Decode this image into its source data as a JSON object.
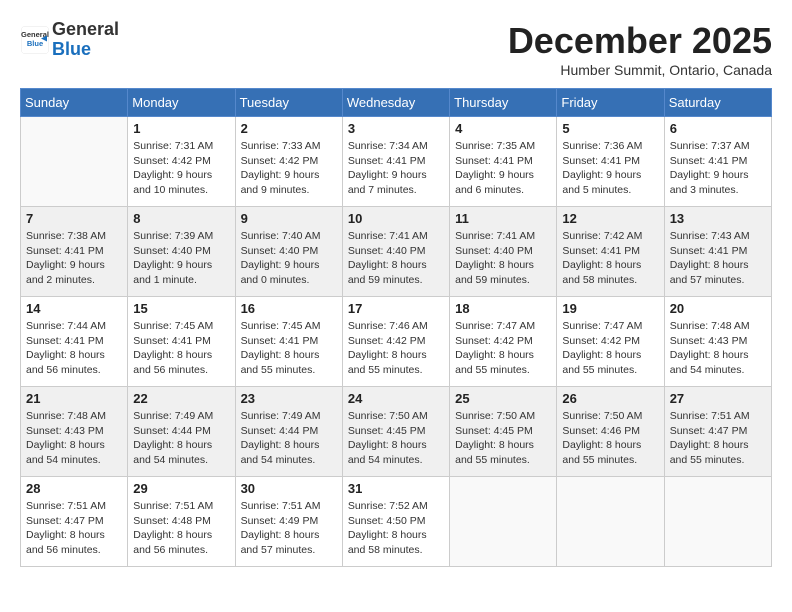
{
  "logo": {
    "general": "General",
    "blue": "Blue"
  },
  "title": "December 2025",
  "location": "Humber Summit, Ontario, Canada",
  "days_of_week": [
    "Sunday",
    "Monday",
    "Tuesday",
    "Wednesday",
    "Thursday",
    "Friday",
    "Saturday"
  ],
  "weeks": [
    {
      "shaded": false,
      "days": [
        {
          "empty": true
        },
        {
          "number": "1",
          "sunrise": "Sunrise: 7:31 AM",
          "sunset": "Sunset: 4:42 PM",
          "daylight": "Daylight: 9 hours and 10 minutes."
        },
        {
          "number": "2",
          "sunrise": "Sunrise: 7:33 AM",
          "sunset": "Sunset: 4:42 PM",
          "daylight": "Daylight: 9 hours and 9 minutes."
        },
        {
          "number": "3",
          "sunrise": "Sunrise: 7:34 AM",
          "sunset": "Sunset: 4:41 PM",
          "daylight": "Daylight: 9 hours and 7 minutes."
        },
        {
          "number": "4",
          "sunrise": "Sunrise: 7:35 AM",
          "sunset": "Sunset: 4:41 PM",
          "daylight": "Daylight: 9 hours and 6 minutes."
        },
        {
          "number": "5",
          "sunrise": "Sunrise: 7:36 AM",
          "sunset": "Sunset: 4:41 PM",
          "daylight": "Daylight: 9 hours and 5 minutes."
        },
        {
          "number": "6",
          "sunrise": "Sunrise: 7:37 AM",
          "sunset": "Sunset: 4:41 PM",
          "daylight": "Daylight: 9 hours and 3 minutes."
        }
      ]
    },
    {
      "shaded": true,
      "days": [
        {
          "number": "7",
          "sunrise": "Sunrise: 7:38 AM",
          "sunset": "Sunset: 4:41 PM",
          "daylight": "Daylight: 9 hours and 2 minutes."
        },
        {
          "number": "8",
          "sunrise": "Sunrise: 7:39 AM",
          "sunset": "Sunset: 4:40 PM",
          "daylight": "Daylight: 9 hours and 1 minute."
        },
        {
          "number": "9",
          "sunrise": "Sunrise: 7:40 AM",
          "sunset": "Sunset: 4:40 PM",
          "daylight": "Daylight: 9 hours and 0 minutes."
        },
        {
          "number": "10",
          "sunrise": "Sunrise: 7:41 AM",
          "sunset": "Sunset: 4:40 PM",
          "daylight": "Daylight: 8 hours and 59 minutes."
        },
        {
          "number": "11",
          "sunrise": "Sunrise: 7:41 AM",
          "sunset": "Sunset: 4:40 PM",
          "daylight": "Daylight: 8 hours and 59 minutes."
        },
        {
          "number": "12",
          "sunrise": "Sunrise: 7:42 AM",
          "sunset": "Sunset: 4:41 PM",
          "daylight": "Daylight: 8 hours and 58 minutes."
        },
        {
          "number": "13",
          "sunrise": "Sunrise: 7:43 AM",
          "sunset": "Sunset: 4:41 PM",
          "daylight": "Daylight: 8 hours and 57 minutes."
        }
      ]
    },
    {
      "shaded": false,
      "days": [
        {
          "number": "14",
          "sunrise": "Sunrise: 7:44 AM",
          "sunset": "Sunset: 4:41 PM",
          "daylight": "Daylight: 8 hours and 56 minutes."
        },
        {
          "number": "15",
          "sunrise": "Sunrise: 7:45 AM",
          "sunset": "Sunset: 4:41 PM",
          "daylight": "Daylight: 8 hours and 56 minutes."
        },
        {
          "number": "16",
          "sunrise": "Sunrise: 7:45 AM",
          "sunset": "Sunset: 4:41 PM",
          "daylight": "Daylight: 8 hours and 55 minutes."
        },
        {
          "number": "17",
          "sunrise": "Sunrise: 7:46 AM",
          "sunset": "Sunset: 4:42 PM",
          "daylight": "Daylight: 8 hours and 55 minutes."
        },
        {
          "number": "18",
          "sunrise": "Sunrise: 7:47 AM",
          "sunset": "Sunset: 4:42 PM",
          "daylight": "Daylight: 8 hours and 55 minutes."
        },
        {
          "number": "19",
          "sunrise": "Sunrise: 7:47 AM",
          "sunset": "Sunset: 4:42 PM",
          "daylight": "Daylight: 8 hours and 55 minutes."
        },
        {
          "number": "20",
          "sunrise": "Sunrise: 7:48 AM",
          "sunset": "Sunset: 4:43 PM",
          "daylight": "Daylight: 8 hours and 54 minutes."
        }
      ]
    },
    {
      "shaded": true,
      "days": [
        {
          "number": "21",
          "sunrise": "Sunrise: 7:48 AM",
          "sunset": "Sunset: 4:43 PM",
          "daylight": "Daylight: 8 hours and 54 minutes."
        },
        {
          "number": "22",
          "sunrise": "Sunrise: 7:49 AM",
          "sunset": "Sunset: 4:44 PM",
          "daylight": "Daylight: 8 hours and 54 minutes."
        },
        {
          "number": "23",
          "sunrise": "Sunrise: 7:49 AM",
          "sunset": "Sunset: 4:44 PM",
          "daylight": "Daylight: 8 hours and 54 minutes."
        },
        {
          "number": "24",
          "sunrise": "Sunrise: 7:50 AM",
          "sunset": "Sunset: 4:45 PM",
          "daylight": "Daylight: 8 hours and 54 minutes."
        },
        {
          "number": "25",
          "sunrise": "Sunrise: 7:50 AM",
          "sunset": "Sunset: 4:45 PM",
          "daylight": "Daylight: 8 hours and 55 minutes."
        },
        {
          "number": "26",
          "sunrise": "Sunrise: 7:50 AM",
          "sunset": "Sunset: 4:46 PM",
          "daylight": "Daylight: 8 hours and 55 minutes."
        },
        {
          "number": "27",
          "sunrise": "Sunrise: 7:51 AM",
          "sunset": "Sunset: 4:47 PM",
          "daylight": "Daylight: 8 hours and 55 minutes."
        }
      ]
    },
    {
      "shaded": false,
      "days": [
        {
          "number": "28",
          "sunrise": "Sunrise: 7:51 AM",
          "sunset": "Sunset: 4:47 PM",
          "daylight": "Daylight: 8 hours and 56 minutes."
        },
        {
          "number": "29",
          "sunrise": "Sunrise: 7:51 AM",
          "sunset": "Sunset: 4:48 PM",
          "daylight": "Daylight: 8 hours and 56 minutes."
        },
        {
          "number": "30",
          "sunrise": "Sunrise: 7:51 AM",
          "sunset": "Sunset: 4:49 PM",
          "daylight": "Daylight: 8 hours and 57 minutes."
        },
        {
          "number": "31",
          "sunrise": "Sunrise: 7:52 AM",
          "sunset": "Sunset: 4:50 PM",
          "daylight": "Daylight: 8 hours and 58 minutes."
        },
        {
          "empty": true
        },
        {
          "empty": true
        },
        {
          "empty": true
        }
      ]
    }
  ]
}
